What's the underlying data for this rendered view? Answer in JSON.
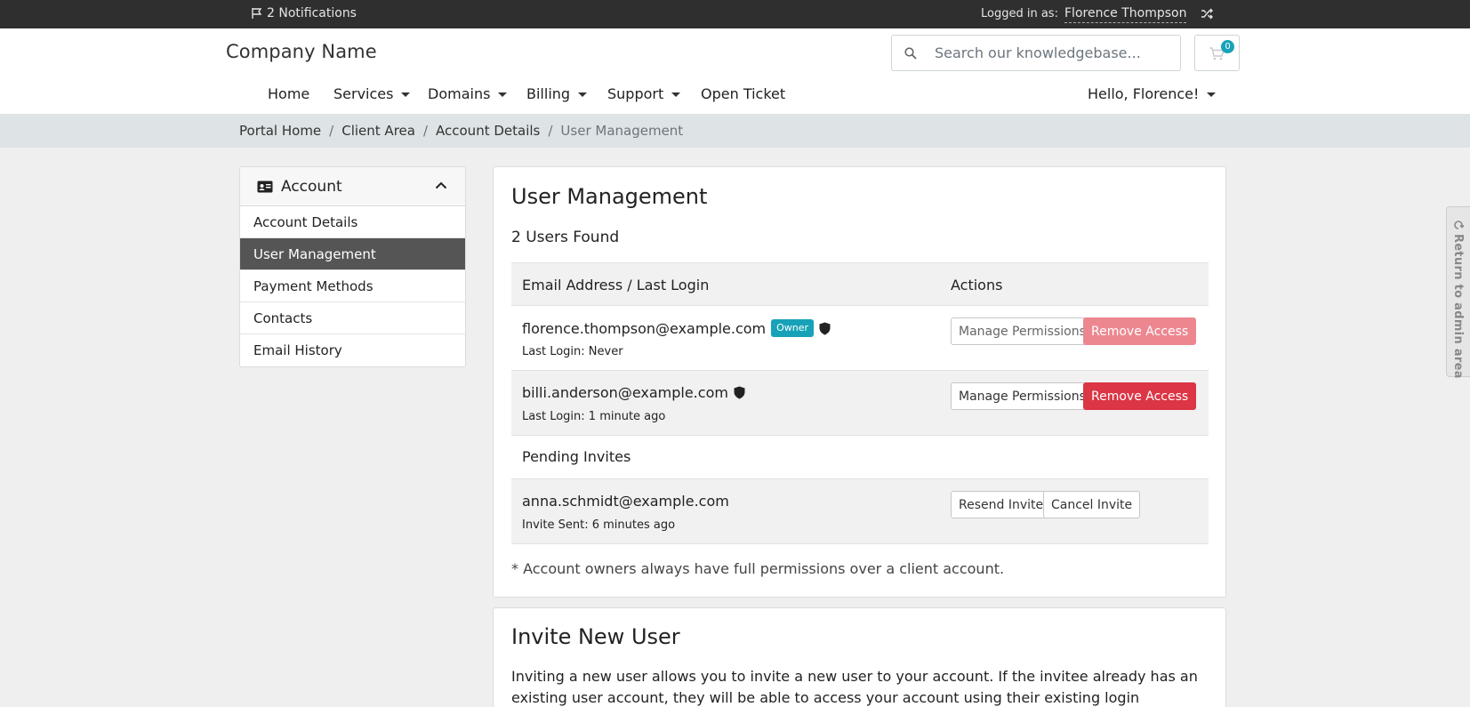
{
  "topbar": {
    "notifications": "2 Notifications",
    "logged_in_label": "Logged in as:",
    "logged_in_user": "Florence Thompson"
  },
  "header": {
    "brand": "Company Name",
    "search_placeholder": "Search our knowledgebase...",
    "cart_count": "0",
    "nav": {
      "home": "Home",
      "services": "Services",
      "domains": "Domains",
      "billing": "Billing",
      "support": "Support",
      "open_ticket": "Open Ticket",
      "greeting": "Hello, Florence!"
    }
  },
  "breadcrumb": [
    "Portal Home",
    "Client Area",
    "Account Details",
    "User Management"
  ],
  "sidebar": {
    "title": "Account",
    "items": [
      "Account Details",
      "User Management",
      "Payment Methods",
      "Contacts",
      "Email History"
    ],
    "active": "User Management"
  },
  "user_management": {
    "title": "User Management",
    "count_text": "2 Users Found",
    "col_email": "Email Address / Last Login",
    "col_actions": "Actions",
    "users": [
      {
        "email": "florence.thompson@example.com",
        "badge": "Owner",
        "last_login": "Last Login: Never",
        "manage": "Manage Permissions",
        "remove": "Remove Access"
      },
      {
        "email": "billi.anderson@example.com",
        "last_login": "Last Login: 1 minute ago",
        "manage": "Manage Permissions",
        "remove": "Remove Access"
      }
    ],
    "pending_title": "Pending Invites",
    "invites": [
      {
        "email": "anna.schmidt@example.com",
        "sent": "Invite Sent: 6 minutes ago",
        "resend": "Resend Invite",
        "cancel": "Cancel Invite"
      }
    ],
    "footnote": "* Account owners always have full permissions over a client account."
  },
  "invite": {
    "title": "Invite New User",
    "text": "Inviting a new user allows you to invite a new user to your account. If the invitee already has an existing user account, they will be able to access your account using their existing login credentials. If the user"
  },
  "admin_tab": {
    "label": "Return to admin area"
  },
  "colors": {
    "accent": "#17a2b8",
    "danger": "#dc3545",
    "topbar": "#2f2f2f",
    "sidebar_active": "#555555"
  }
}
